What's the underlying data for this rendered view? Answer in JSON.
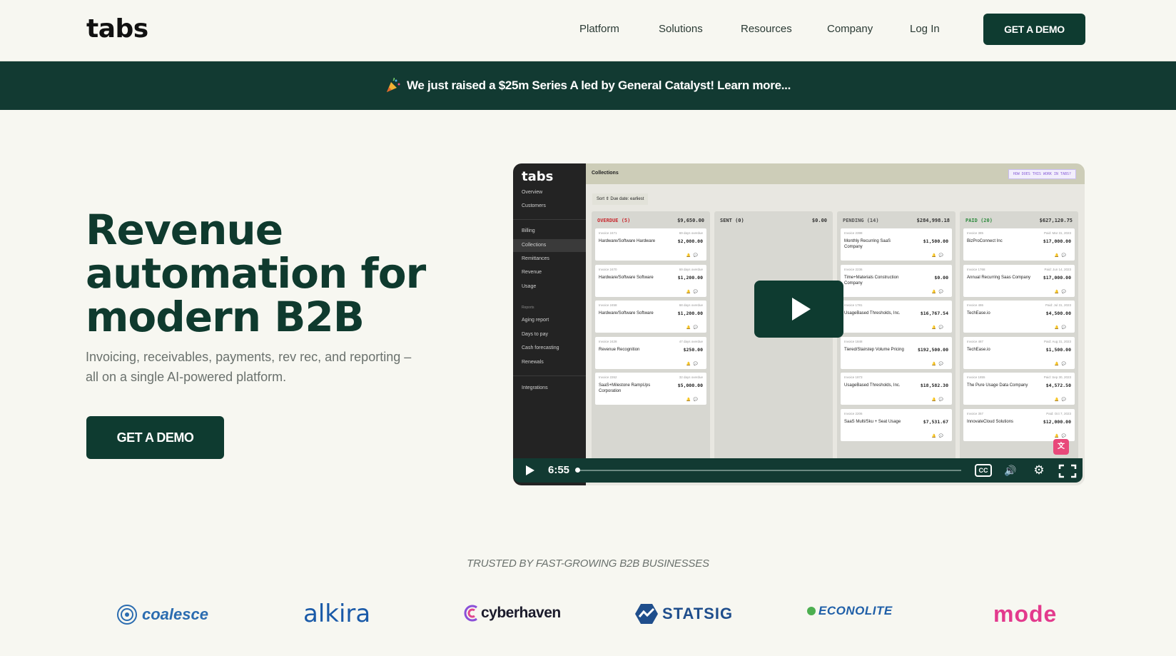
{
  "header": {
    "logo": "tabs",
    "nav": [
      "Platform",
      "Solutions",
      "Resources",
      "Company",
      "Log In"
    ],
    "cta": "GET A DEMO"
  },
  "banner": {
    "text": "We just raised a $25m Series A led by General Catalyst! Learn more..."
  },
  "hero": {
    "title": "Revenue automation for modern B2B",
    "subtitle": "Invoicing, receivables, payments, rev rec, and reporting – all on a single AI-powered platform.",
    "cta": "GET A DEMO"
  },
  "video": {
    "app_logo": "tabs",
    "sidebar": [
      "Overview",
      "Customers",
      "Billing",
      "Collections",
      "Remittances",
      "Revenue",
      "Usage",
      "Reports",
      "Aging report",
      "Days to pay",
      "Cash forecasting",
      "Renewals",
      "Integrations"
    ],
    "page_title": "Collections",
    "help_link": "HOW DOES THIS WORK IN TABS?",
    "sort": "Sort ⇕  Due date: earliest",
    "columns": [
      {
        "name": "OVERDUE (5)",
        "amount": "$9,650.00",
        "color": "#c8282e",
        "cards": [
          {
            "inv": "Invoice 2471",
            "due": "69 days overdue",
            "customer": "Hardware/Software Hardware",
            "amount": "$2,000.00"
          },
          {
            "inv": "Invoice 2470",
            "due": "69 days overdue",
            "customer": "Hardware/Software Software",
            "amount": "$1,200.00"
          },
          {
            "inv": "Invoice 2458",
            "due": "68 days overdue",
            "customer": "Hardware/Software Software",
            "amount": "$1,200.00"
          },
          {
            "inv": "Invoice 2428",
            "due": "47 days overdue",
            "customer": "Revenue Recognition",
            "amount": "$250.00"
          },
          {
            "inv": "Invoice 2262",
            "due": "32 days overdue",
            "customer": "SaaS+Milestone RampUps Corporation",
            "amount": "$5,000.00"
          }
        ]
      },
      {
        "name": "SENT (0)",
        "amount": "$0.00",
        "color": "#333333",
        "cards": []
      },
      {
        "name": "PENDING (14)",
        "amount": "$284,998.18",
        "color": "#555555",
        "cards": [
          {
            "inv": "Invoice 2398",
            "due": "",
            "customer": "Monthly Recurring SaaS Company",
            "amount": "$1,500.00"
          },
          {
            "inv": "Invoice 2236",
            "due": "",
            "customer": "Time+Materials Construction Company",
            "amount": "$0.00"
          },
          {
            "inv": "Invoice 1781",
            "due": "",
            "customer": "UsageBased Thresholds, Inc.",
            "amount": "$16,767.54"
          },
          {
            "inv": "Invoice 1848",
            "due": "",
            "customer": "Tiered/Stairstep Volume Pricing",
            "amount": "$192,500.00"
          },
          {
            "inv": "Invoice 1873",
            "due": "",
            "customer": "UsageBased Thresholds, Inc.",
            "amount": "$18,582.30"
          },
          {
            "inv": "Invoice 2206",
            "due": "",
            "customer": "SaaS Multi/Sku + Seat Usage",
            "amount": "$7,531.67"
          }
        ]
      },
      {
        "name": "PAID (20)",
        "amount": "$627,120.75",
        "color": "#2e8b3e",
        "cards": [
          {
            "inv": "Invoice 385",
            "due": "Paid: Mar 31, 2023",
            "customer": "BizProConnect Inc",
            "amount": "$17,000.00"
          },
          {
            "inv": "Invoice 1768",
            "due": "Paid: Jun 14, 2023",
            "customer": "Annual Recurring Saas Company",
            "amount": "$17,000.00"
          },
          {
            "inv": "Invoice 486",
            "due": "Paid: Jul 31, 2023",
            "customer": "TechEase.io",
            "amount": "$4,500.00"
          },
          {
            "inv": "Invoice 487",
            "due": "Paid: Aug 31, 2023",
            "customer": "TechEase.io",
            "amount": "$1,500.00"
          },
          {
            "inv": "Invoice 1855",
            "due": "Paid: Sep 30, 2023",
            "customer": "The Pure Usage Data Company",
            "amount": "$4,572.50"
          },
          {
            "inv": "Invoice 357",
            "due": "Paid: Oct 7, 2023",
            "customer": "InnovateCloud Solutions",
            "amount": "$12,000.00"
          }
        ]
      }
    ],
    "time": "6:55",
    "progress": 0.0
  },
  "trusted": {
    "heading": "TRUSTED BY FAST-GROWING B2B BUSINESSES",
    "logos": [
      "coalesce",
      "alkira",
      "cyberhaven",
      "STATSIG",
      "ECONOLITE",
      "mode"
    ]
  }
}
